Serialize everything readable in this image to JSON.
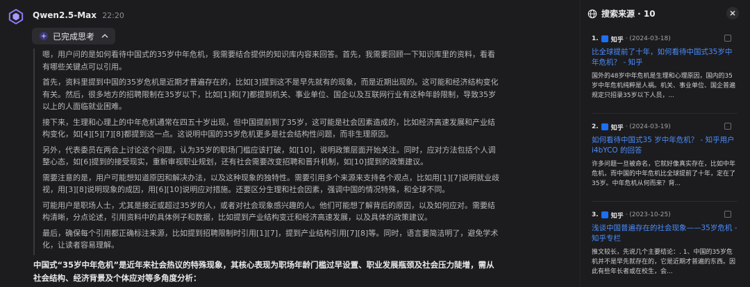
{
  "message": {
    "model": "Qwen2.5-Max",
    "time": "22:20",
    "thinking_label": "已完成思考",
    "thinking_paragraphs": [
      "嗯，用户问的是如何看待中国式的35岁中年危机，我需要结合提供的知识库内容来回答。首先，我需要回顾一下知识库里的资料，看看有哪些关键点可以引用。",
      "首先，资料里提到中国的35岁危机是近期才普遍存在的，比如[3]提到这不是早先就有的现象，而是近期出现的。这可能和经济结构变化有关。然后，很多地方的招聘限制在35岁以下，比如[1]和[7]都提到机关、事业单位、国企以及互联网行业有这种年龄限制，导致35岁以上的人面临就业困难。",
      "接下来，生理和心理上的中年危机通常在四五十岁出现，但中国提前到了35岁，这可能是社会因素造成的，比如经济高速发展和产业结构变化，如[4][5][7][8]都提到这一点。这说明中国的35岁危机更多是社会结构性问题，而非生理原因。",
      "另外，代表委员在两会上讨论这个问题，认为35岁的职场门槛应该打破，如[10]，说明政策层面开始关注。同时，应对方法包括个人调整心态，如[6]提到的接受现实，重新审视职业规划，还有社会需要改变招聘和晋升机制，如[10]提到的政策建议。",
      "需要注意的是，用户可能想知道原因和解决办法，以及这种现象的独特性。需要引用多个来源来支持各个观点，比如用[1][7]说明就业歧视，用[3][8]说明现象的成因，用[6][10]说明应对措施。还要区分生理和社会因素，强调中国的情况特殊，和全球不同。",
      "可能用户是职场人士，尤其是接近或超过35岁的人，或者对社会现象感兴趣的人。他们可能想了解背后的原因，以及如何应对。需要结构清晰，分点论述，引用资料中的具体例子和数据，比如提到产业结构变迁和经济高速发展，以及具体的政策建议。",
      "最后，确保每个引用都正确标注来源，比如提到招聘限制时引用[1][7]，提到产业结构引用[7][8]等。同时，语言要简洁明了，避免学术化，让读者容易理解。"
    ],
    "answer": "中国式“35岁中年危机”是近年来社会热议的特殊现象，其核心表现为职场年龄门槛过早设置、职业发展瓶颈及社会压力陡增，需从社会结构、经济背景及个体应对等多角度分析："
  },
  "sources_panel": {
    "title": "搜索来源 · 10",
    "items": [
      {
        "num": "1.",
        "site": "知乎",
        "date": "· (2024-03-18)",
        "title": "比全球提前了十年，如何看待中国式35岁中年危机？ - 知乎",
        "snippet": "国外的48岁中年危机是生理和心理原因，国内的35岁中年危机纯粹是人祸。机关、事业单位、国企普遍规定只招录35岁以下人员，..."
      },
      {
        "num": "2.",
        "site": "知乎",
        "date": "· (2024-03-19)",
        "title": "如何看待中国式35 岁中年危机？ - 知乎用户i4bYCO 的回答",
        "snippet": "许多问题一旦被命名，它就好像真实存在，比如中年危机，而中国的中年危机比全球提前了十年，定在了35岁。中年危机从何而来？背..."
      },
      {
        "num": "3.",
        "site": "知乎",
        "date": "· (2023-10-25)",
        "title": "浅谈中国普遍存在的社会现象——35岁危机 - 知乎专栏",
        "snippet": "推文较长，先说几个主要结论：. 1、中国的35岁危机并不是早先就存在的，它是近期才普遍的东西。因此有些年长者或在校生，会..."
      }
    ]
  },
  "colors": {
    "background": "#1c1c1e",
    "link": "#4a8dff",
    "zhihu_brand": "#1c6ff5"
  }
}
